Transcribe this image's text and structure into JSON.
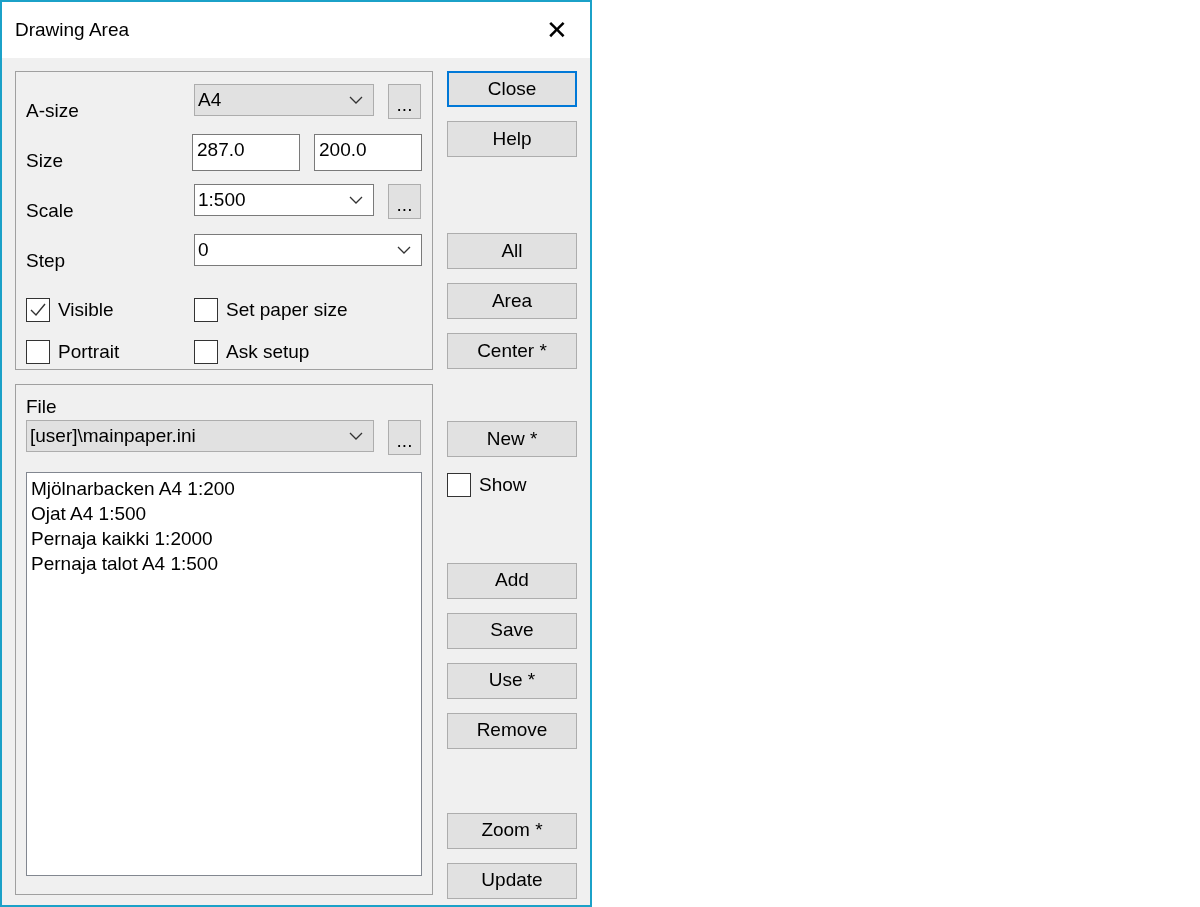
{
  "window": {
    "title": "Drawing Area",
    "close": "✕"
  },
  "settings": {
    "rows": [
      {
        "kind": "dropdown",
        "label": "A-size",
        "value": "A4",
        "browse": "..."
      },
      {
        "kind": "pair",
        "label": "Size",
        "values": [
          "287.0",
          "200.0"
        ]
      },
      {
        "kind": "combo",
        "label": "Scale",
        "value": "1:500",
        "browse": "..."
      },
      {
        "kind": "combo",
        "label": "Step",
        "value": "0"
      }
    ],
    "checkboxes": [
      {
        "label": "Visible",
        "checked": true
      },
      {
        "label": "Set paper size",
        "checked": false
      },
      {
        "label": "Portrait",
        "checked": false
      },
      {
        "label": "Ask setup",
        "checked": false
      }
    ]
  },
  "file": {
    "label": "File",
    "kind": "dropdown",
    "value": "[user]\\mainpaper.ini",
    "browse": "...",
    "items": [
      {
        "label": "Mjölnarbacken A4 1:200",
        "selected": false
      },
      {
        "label": "Ojat A4 1:500",
        "selected": false
      },
      {
        "label": "Pernaja kaikki 1:2000",
        "selected": false
      },
      {
        "label": "Pernaja talot A4 1:500",
        "selected": false
      }
    ]
  },
  "side_groups": [
    [
      {
        "kind": "button",
        "label": "Close",
        "default": true
      },
      {
        "kind": "button",
        "label": "Help",
        "default": false
      }
    ],
    [
      {
        "kind": "button",
        "label": "All",
        "default": false
      },
      {
        "kind": "button",
        "label": "Area",
        "default": false
      },
      {
        "kind": "button",
        "label": "Center *",
        "default": false
      }
    ],
    [
      {
        "kind": "button",
        "label": "New *",
        "default": false
      },
      {
        "kind": "checkbox",
        "label": "Show",
        "checked": false
      }
    ],
    [
      {
        "kind": "button",
        "label": "Add",
        "default": false
      },
      {
        "kind": "button",
        "label": "Save",
        "default": false
      },
      {
        "kind": "button",
        "label": "Use *",
        "default": false
      },
      {
        "kind": "button",
        "label": "Remove",
        "default": false
      }
    ],
    [
      {
        "kind": "button",
        "label": "Zoom *",
        "default": false
      },
      {
        "kind": "button",
        "label": "Update",
        "default": false
      }
    ]
  ]
}
